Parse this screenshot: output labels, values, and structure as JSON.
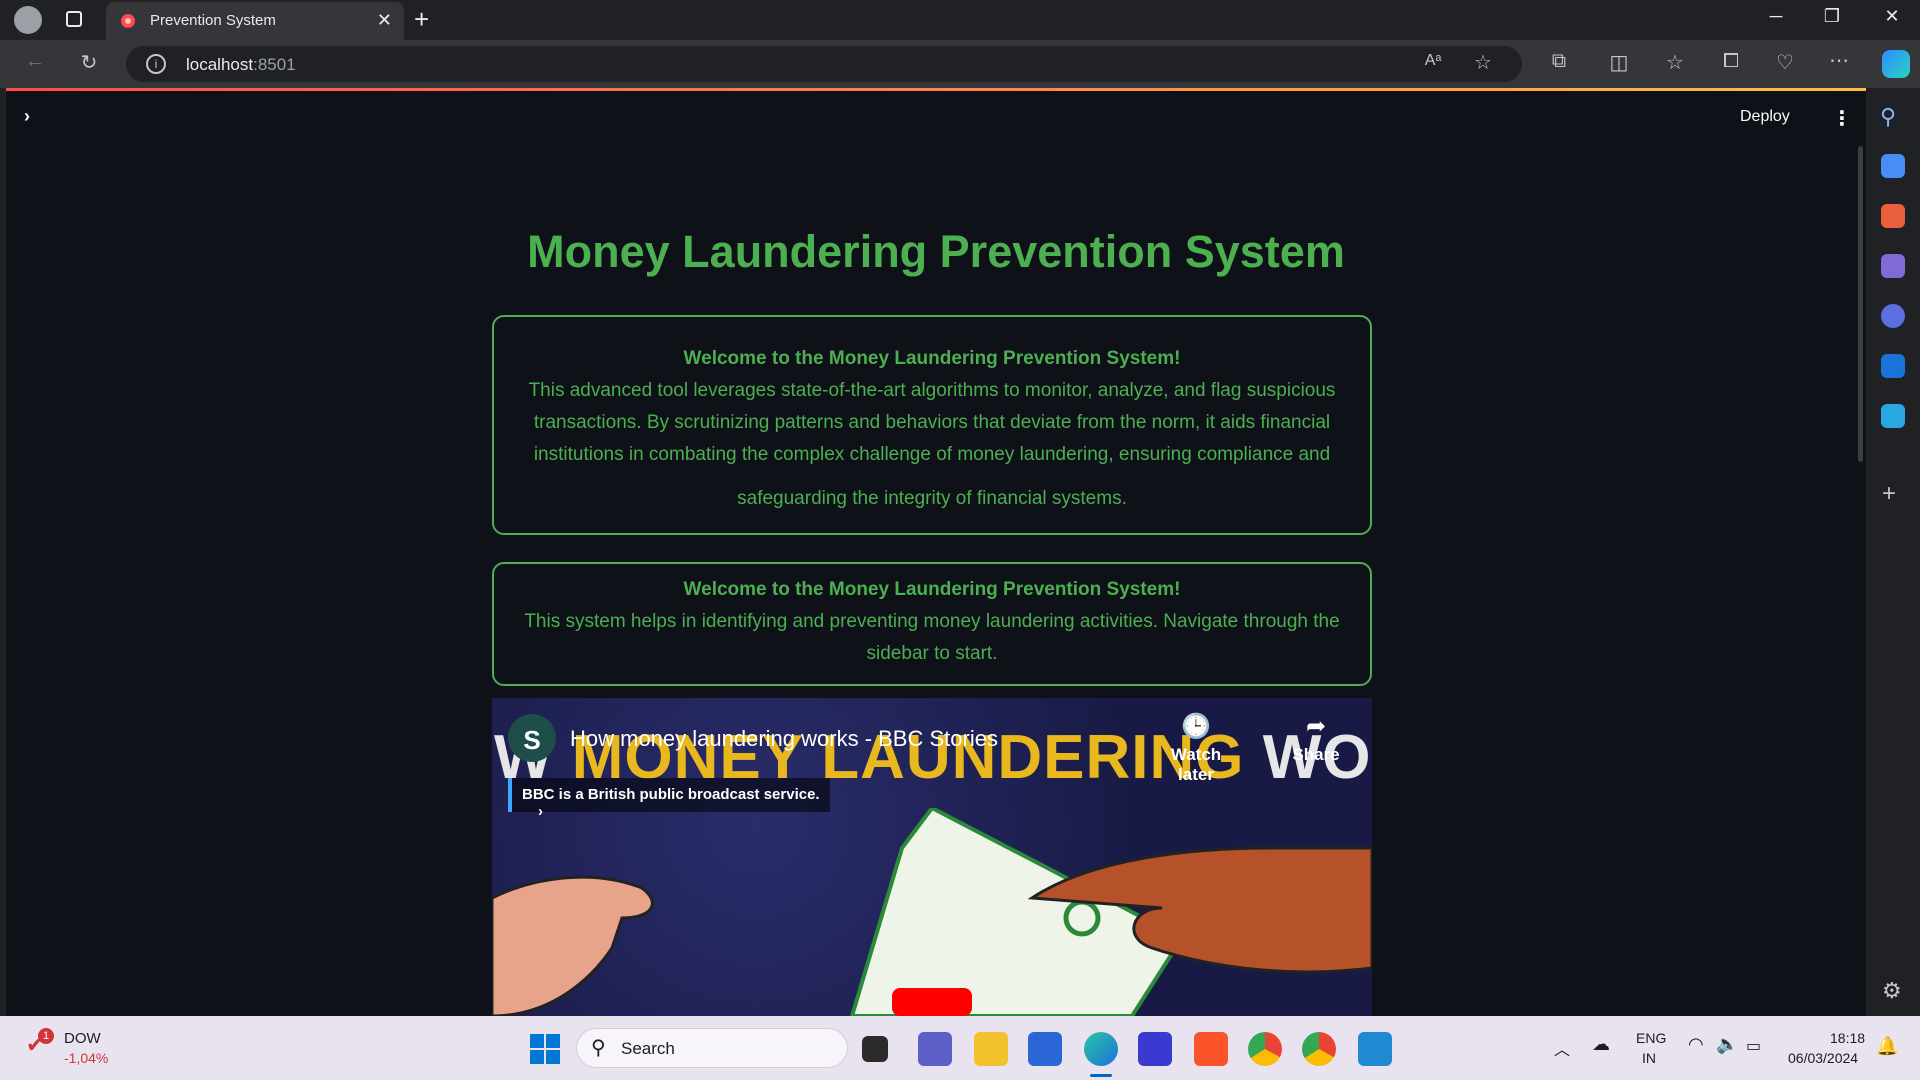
{
  "browser": {
    "tab_title": "Prevention System",
    "url_host": "localhost",
    "url_port": ":8501"
  },
  "app": {
    "deploy_label": "Deploy",
    "title": "Money Laundering Prevention System",
    "card1": {
      "heading": "Welcome to the Money Laundering Prevention System!",
      "body": "This advanced tool leverages state-of-the-art algorithms to monitor, analyze, and flag suspicious transactions. By scrutinizing patterns and behaviors that deviate from the norm, it aids financial institutions in combating the complex challenge of money laundering, ensuring compliance and",
      "body_last": "safeguarding the integrity of financial systems."
    },
    "card2": {
      "heading": "Welcome to the Money Laundering Prevention System!",
      "body": "This system helps in identifying and preventing money laundering activities. Navigate through the sidebar to start."
    },
    "video": {
      "title": "How money laundering works - BBC Stories",
      "channel_logo_text": "S",
      "info_badge": "BBC is a British public broadcast service.",
      "watch_later": "Watch later",
      "share": "Share",
      "thumbnail_text_left": "W ",
      "thumbnail_text_main": "MONEY LAUNDERING",
      "thumbnail_text_right": " WOR"
    }
  },
  "taskbar": {
    "widget_title": "DOW",
    "widget_value": "-1,04%",
    "widget_badge": "1",
    "search_placeholder": "Search",
    "lang_top": "ENG",
    "lang_bottom": "IN",
    "time": "18:18",
    "date": "06/03/2024"
  },
  "colors": {
    "accent_green": "#4caf50",
    "app_bg": "#0e1117",
    "stock_down": "#d13438"
  }
}
